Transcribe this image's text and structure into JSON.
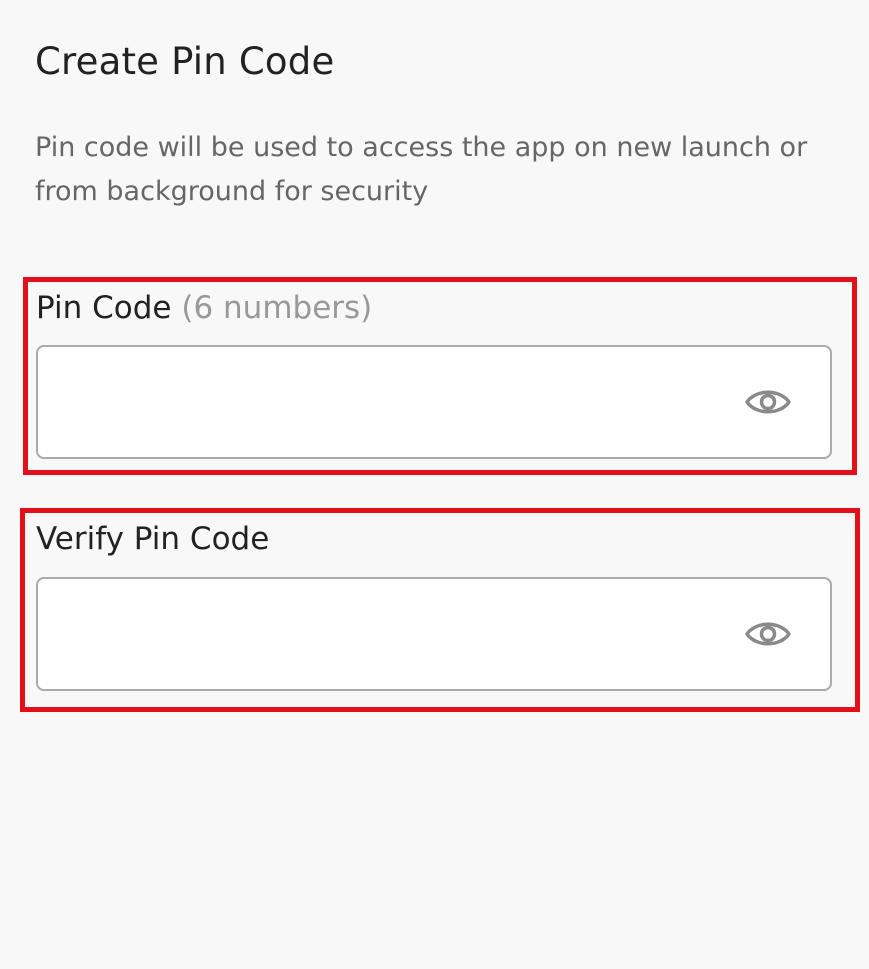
{
  "header": {
    "title": "Create Pin Code",
    "description": "Pin code will be used to access the app on new launch or from background for security"
  },
  "pin_field": {
    "label": "Pin Code",
    "hint": "(6 numbers)",
    "value": "",
    "placeholder": "",
    "toggle_icon": "eye-icon"
  },
  "verify_field": {
    "label": "Verify Pin Code",
    "value": "",
    "placeholder": "",
    "toggle_icon": "eye-icon"
  },
  "colors": {
    "highlight_border": "#e3101a",
    "background": "#f8f8f8",
    "hint_text": "#999999",
    "icon": "#8a8a8a"
  }
}
